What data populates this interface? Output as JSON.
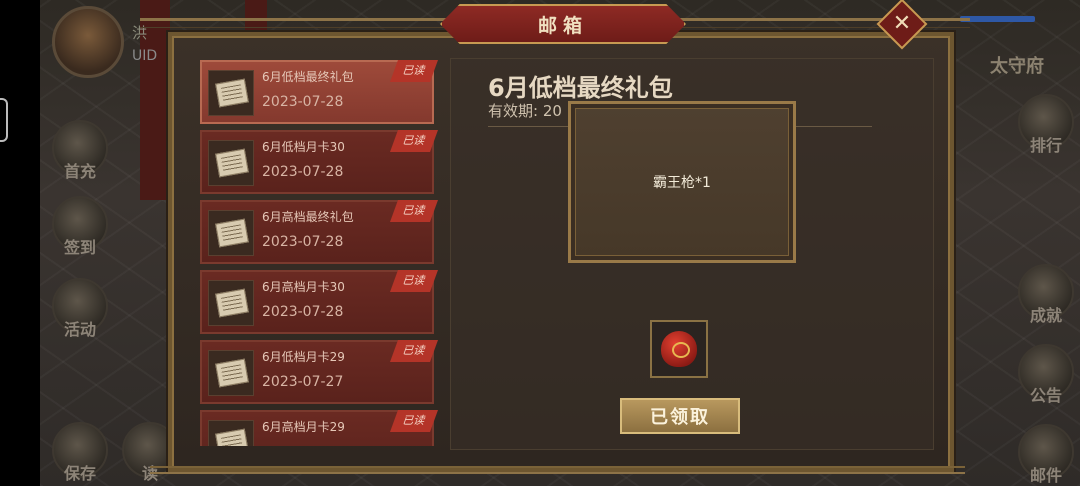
{
  "panel": {
    "title": "邮箱",
    "close_symbol": "✕"
  },
  "background": {
    "player_name": "洪",
    "uid_label": "UID",
    "city_name": "太守府",
    "left_buttons": [
      {
        "label": "首充",
        "icon": "gift-icon"
      },
      {
        "label": "签到",
        "icon": "calendar-icon"
      },
      {
        "label": "活动",
        "icon": "event-icon"
      },
      {
        "label": "保存",
        "icon": "save-icon"
      },
      {
        "label": "读",
        "icon": "read-icon"
      }
    ],
    "right_buttons": [
      {
        "label": "排行",
        "icon": "ranking-icon"
      },
      {
        "label": "成就",
        "icon": "achievement-icon"
      },
      {
        "label": "公告",
        "icon": "notice-icon"
      },
      {
        "label": "邮件",
        "icon": "mail-icon"
      }
    ]
  },
  "mails": [
    {
      "title": "6月低档最终礼包",
      "date": "2023-07-28",
      "tag": "已读",
      "selected": true
    },
    {
      "title": "6月低档月卡30",
      "date": "2023-07-28",
      "tag": "已读",
      "selected": false
    },
    {
      "title": "6月高档最终礼包",
      "date": "2023-07-28",
      "tag": "已读",
      "selected": false
    },
    {
      "title": "6月高档月卡30",
      "date": "2023-07-28",
      "tag": "已读",
      "selected": false
    },
    {
      "title": "6月低档月卡29",
      "date": "2023-07-27",
      "tag": "已读",
      "selected": false
    },
    {
      "title": "6月高档月卡29",
      "date": "",
      "tag": "已读",
      "selected": false
    }
  ],
  "detail": {
    "title": "6月低档最终礼包",
    "validity": "有效期: 20",
    "reward_popup_text": "霸王枪*1",
    "attachment_icon": "red-pouch-icon",
    "claim_button": "已领取"
  }
}
